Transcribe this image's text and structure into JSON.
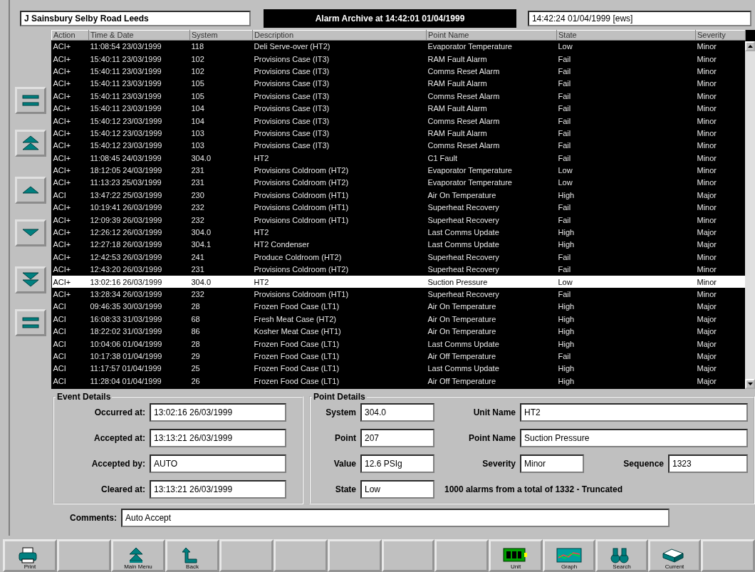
{
  "header": {
    "site": "J Sainsbury Selby Road Leeds",
    "title": "Alarm Archive at 14:42:01 01/04/1999",
    "clock": "14:42:24 01/04/1999 [ews]"
  },
  "nav_buttons": [
    {
      "kind": "first"
    },
    {
      "kind": "page_up"
    },
    {
      "kind": "up"
    },
    {
      "kind": "down"
    },
    {
      "kind": "page_down"
    },
    {
      "kind": "last"
    }
  ],
  "table": {
    "columns": [
      "Action",
      "Time & Date",
      "System",
      "Description",
      "Point Name",
      "State",
      "Severity"
    ],
    "rows": [
      {
        "cells": [
          "ACI+",
          "11:08:54 23/03/1999",
          "118",
          "Deli Serve-over (HT2)",
          "Evaporator Temperature",
          "Low",
          "Minor"
        ],
        "selected": false
      },
      {
        "cells": [
          "ACI+",
          "15:40:11 23/03/1999",
          "102",
          "Provisions Case (IT3)",
          "RAM Fault Alarm",
          "Fail",
          "Minor"
        ],
        "selected": false
      },
      {
        "cells": [
          "ACI+",
          "15:40:11 23/03/1999",
          "102",
          "Provisions Case (IT3)",
          "Comms Reset Alarm",
          "Fail",
          "Minor"
        ],
        "selected": false
      },
      {
        "cells": [
          "ACI+",
          "15:40:11 23/03/1999",
          "105",
          "Provisions Case (IT3)",
          "RAM Fault Alarm",
          "Fail",
          "Minor"
        ],
        "selected": false
      },
      {
        "cells": [
          "ACI+",
          "15:40:11 23/03/1999",
          "105",
          "Provisions Case (IT3)",
          "Comms Reset Alarm",
          "Fail",
          "Minor"
        ],
        "selected": false
      },
      {
        "cells": [
          "ACI+",
          "15:40:11 23/03/1999",
          "104",
          "Provisions Case (IT3)",
          "RAM Fault Alarm",
          "Fail",
          "Minor"
        ],
        "selected": false
      },
      {
        "cells": [
          "ACI+",
          "15:40:12 23/03/1999",
          "104",
          "Provisions Case (IT3)",
          "Comms Reset Alarm",
          "Fail",
          "Minor"
        ],
        "selected": false
      },
      {
        "cells": [
          "ACI+",
          "15:40:12 23/03/1999",
          "103",
          "Provisions Case (IT3)",
          "RAM Fault Alarm",
          "Fail",
          "Minor"
        ],
        "selected": false
      },
      {
        "cells": [
          "ACI+",
          "15:40:12 23/03/1999",
          "103",
          "Provisions Case (IT3)",
          "Comms Reset Alarm",
          "Fail",
          "Minor"
        ],
        "selected": false
      },
      {
        "cells": [
          "ACI+",
          "11:08:45 24/03/1999",
          "304.0",
          "HT2",
          "C1 Fault",
          "Fail",
          "Minor"
        ],
        "selected": false
      },
      {
        "cells": [
          "ACI+",
          "18:12:05 24/03/1999",
          "231",
          "Provisions Coldroom (HT2)",
          "Evaporator Temperature",
          "Low",
          "Minor"
        ],
        "selected": false
      },
      {
        "cells": [
          "ACI+",
          "11:13:23 25/03/1999",
          "231",
          "Provisions Coldroom (HT2)",
          "Evaporator Temperature",
          "Low",
          "Minor"
        ],
        "selected": false
      },
      {
        "cells": [
          "ACI",
          "13:47:22 25/03/1999",
          "230",
          "Provisions Coldroom (HT1)",
          "Air On Temperature",
          "High",
          "Major"
        ],
        "selected": false
      },
      {
        "cells": [
          "ACI+",
          "10:19:41 26/03/1999",
          "232",
          "Provisions Coldroom (HT1)",
          "Superheat Recovery",
          "Fail",
          "Minor"
        ],
        "selected": false
      },
      {
        "cells": [
          "ACI+",
          "12:09:39 26/03/1999",
          "232",
          "Provisions Coldroom (HT1)",
          "Superheat Recovery",
          "Fail",
          "Minor"
        ],
        "selected": false
      },
      {
        "cells": [
          "ACI+",
          "12:26:12 26/03/1999",
          "304.0",
          "HT2",
          "Last Comms Update",
          "High",
          "Major"
        ],
        "selected": false
      },
      {
        "cells": [
          "ACI+",
          "12:27:18 26/03/1999",
          "304.1",
          "HT2 Condenser",
          "Last Comms Update",
          "High",
          "Major"
        ],
        "selected": false
      },
      {
        "cells": [
          "ACI+",
          "12:42:53 26/03/1999",
          "241",
          "Produce Coldroom (HT2)",
          "Superheat Recovery",
          "Fail",
          "Minor"
        ],
        "selected": false
      },
      {
        "cells": [
          "ACI+",
          "12:43:20 26/03/1999",
          "231",
          "Provisions Coldroom (HT2)",
          "Superheat Recovery",
          "Fail",
          "Minor"
        ],
        "selected": false
      },
      {
        "cells": [
          "ACI+",
          "13:02:16 26/03/1999",
          "304.0",
          "HT2",
          "Suction Pressure",
          "Low",
          "Minor"
        ],
        "selected": true
      },
      {
        "cells": [
          "ACI+",
          "13:28:34 26/03/1999",
          "232",
          "Provisions Coldroom (HT1)",
          "Superheat Recovery",
          "Fail",
          "Minor"
        ],
        "selected": false
      },
      {
        "cells": [
          "ACI",
          "09:46:35 30/03/1999",
          "28",
          "Frozen Food Case (LT1)",
          "Air On Temperature",
          "High",
          "Major"
        ],
        "selected": false
      },
      {
        "cells": [
          "ACI",
          "16:08:33 31/03/1999",
          "68",
          "Fresh Meat Case (HT2)",
          "Air On Temperature",
          "High",
          "Major"
        ],
        "selected": false
      },
      {
        "cells": [
          "ACI",
          "18:22:02 31/03/1999",
          "86",
          "Kosher Meat Case (HT1)",
          "Air On Temperature",
          "High",
          "Major"
        ],
        "selected": false
      },
      {
        "cells": [
          "ACI",
          "10:04:06 01/04/1999",
          "28",
          "Frozen Food Case (LT1)",
          "Last Comms Update",
          "High",
          "Major"
        ],
        "selected": false
      },
      {
        "cells": [
          "ACI",
          "10:17:38 01/04/1999",
          "29",
          "Frozen Food Case (LT1)",
          "Air Off Temperature",
          "Fail",
          "Major"
        ],
        "selected": false
      },
      {
        "cells": [
          "ACI",
          "11:17:57 01/04/1999",
          "25",
          "Frozen Food Case (LT1)",
          "Last Comms Update",
          "High",
          "Major"
        ],
        "selected": false
      },
      {
        "cells": [
          "ACI",
          "11:28:04 01/04/1999",
          "26",
          "Frozen Food Case (LT1)",
          "Air Off Temperature",
          "High",
          "Major"
        ],
        "selected": false
      }
    ]
  },
  "event_details": {
    "title": "Event Details",
    "fields": [
      {
        "label": "Occurred at:",
        "value": "13:02:16 26/03/1999"
      },
      {
        "label": "Accepted at:",
        "value": "13:13:21 26/03/1999"
      },
      {
        "label": "Accepted by:",
        "value": "AUTO"
      },
      {
        "label": "Cleared at:",
        "value": "13:13:21 26/03/1999"
      }
    ]
  },
  "point_details": {
    "title": "Point Details",
    "system": {
      "label": "System",
      "value": "304.0"
    },
    "point": {
      "label": "Point",
      "value": "207"
    },
    "value": {
      "label": "Value",
      "value": "12.6 PSIg"
    },
    "state": {
      "label": "State",
      "value": "Low"
    },
    "unit_name": {
      "label": "Unit Name",
      "value": "HT2"
    },
    "point_name": {
      "label": "Point Name",
      "value": "Suction Pressure"
    },
    "severity": {
      "label": "Severity",
      "value": "Minor"
    },
    "sequence": {
      "label": "Sequence",
      "value": "1323"
    },
    "summary": "1000 alarms from a total of 1332 - Truncated"
  },
  "comments": {
    "label": "Comments:",
    "value": "Auto Accept"
  },
  "toolbar": [
    {
      "kind": "print",
      "label": "Print"
    },
    {
      "kind": "blank"
    },
    {
      "kind": "main_menu",
      "label": "Main Menu"
    },
    {
      "kind": "back",
      "label": "Back"
    },
    {
      "kind": "blank"
    },
    {
      "kind": "blank"
    },
    {
      "kind": "blank"
    },
    {
      "kind": "blank"
    },
    {
      "kind": "blank"
    },
    {
      "kind": "unit",
      "label": "Unit"
    },
    {
      "kind": "graph",
      "label": "Graph"
    },
    {
      "kind": "search",
      "label": "Search"
    },
    {
      "kind": "current",
      "label": "Current"
    },
    {
      "kind": "blank"
    }
  ]
}
